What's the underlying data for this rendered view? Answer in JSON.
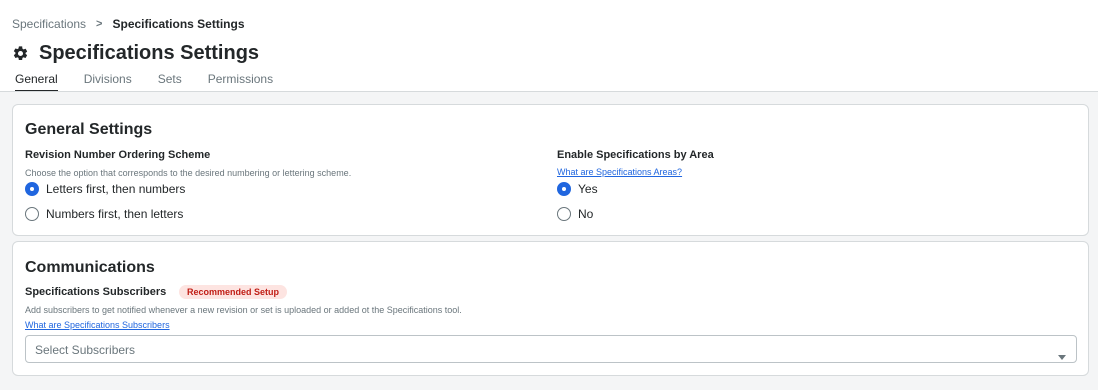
{
  "breadcrumb": {
    "parent": "Specifications",
    "separator": ">",
    "current": "Specifications Settings"
  },
  "page": {
    "title": "Specifications Settings",
    "icon": "gear-icon"
  },
  "tabs": [
    {
      "label": "General",
      "active": true
    },
    {
      "label": "Divisions",
      "active": false
    },
    {
      "label": "Sets",
      "active": false
    },
    {
      "label": "Permissions",
      "active": false
    }
  ],
  "general_settings": {
    "title": "General Settings",
    "revision": {
      "label": "Revision Number Ordering Scheme",
      "help": "Choose the option that corresponds to the desired numbering or lettering scheme.",
      "options": [
        {
          "label": "Letters first, then numbers",
          "checked": true
        },
        {
          "label": "Numbers first, then letters",
          "checked": false
        }
      ]
    },
    "by_area": {
      "label": "Enable Specifications by Area",
      "link": "What are Specifications Areas?",
      "options": [
        {
          "label": "Yes",
          "checked": true
        },
        {
          "label": "No",
          "checked": false
        }
      ]
    }
  },
  "communications": {
    "title": "Communications",
    "subscribers": {
      "label": "Specifications Subscribers",
      "badge": "Recommended Setup",
      "help": "Add subscribers to get notified whenever a new revision or set is uploaded or added ot the Specifications tool.",
      "link": "What are Specifications Subscribers",
      "select_placeholder": "Select Subscribers"
    }
  },
  "colors": {
    "accent": "#2066df",
    "badge_bg": "#fde4e1",
    "badge_text": "#c01d15",
    "content_bg": "#f4f5f6"
  }
}
